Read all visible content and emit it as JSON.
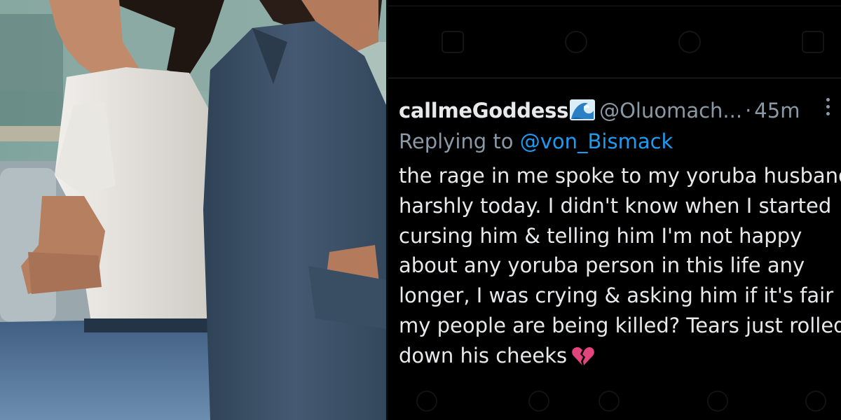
{
  "photo": {
    "alt": "woman-and-man-back-to-back",
    "colors": {
      "wall": "#6f8f8a",
      "shirt_white": "#e4e2de",
      "shirt_denim": "#3d5168",
      "jeans": "#4f6f92",
      "skin": "#b88263",
      "hair": "#2a1c16"
    }
  },
  "tweet": {
    "display_name": "callmeGoddess",
    "name_emoji": "water-wave-icon",
    "handle": "@Oluomach...",
    "separator": "·",
    "time": "45m",
    "more_icon": "more-options-icon",
    "reply_prefix": "Replying to",
    "reply_to": "@von_Bismack",
    "body_lines": [
      "the rage in me spoke to my yoruba husband",
      "harshly today. I didn't know when I started",
      "cursing him & telling him I'm not happy",
      "about any yoruba person in this life any",
      "longer, I was crying & asking him if it's fair",
      "my people are being killed? Tears just rolled",
      "down his cheeks"
    ],
    "body_emoji": "broken-heart-icon"
  },
  "colors": {
    "background": "#000000",
    "text_primary": "#e7e9ea",
    "text_secondary": "#8b98a5",
    "link": "#1d9bf0",
    "heart": "#e2457b"
  }
}
